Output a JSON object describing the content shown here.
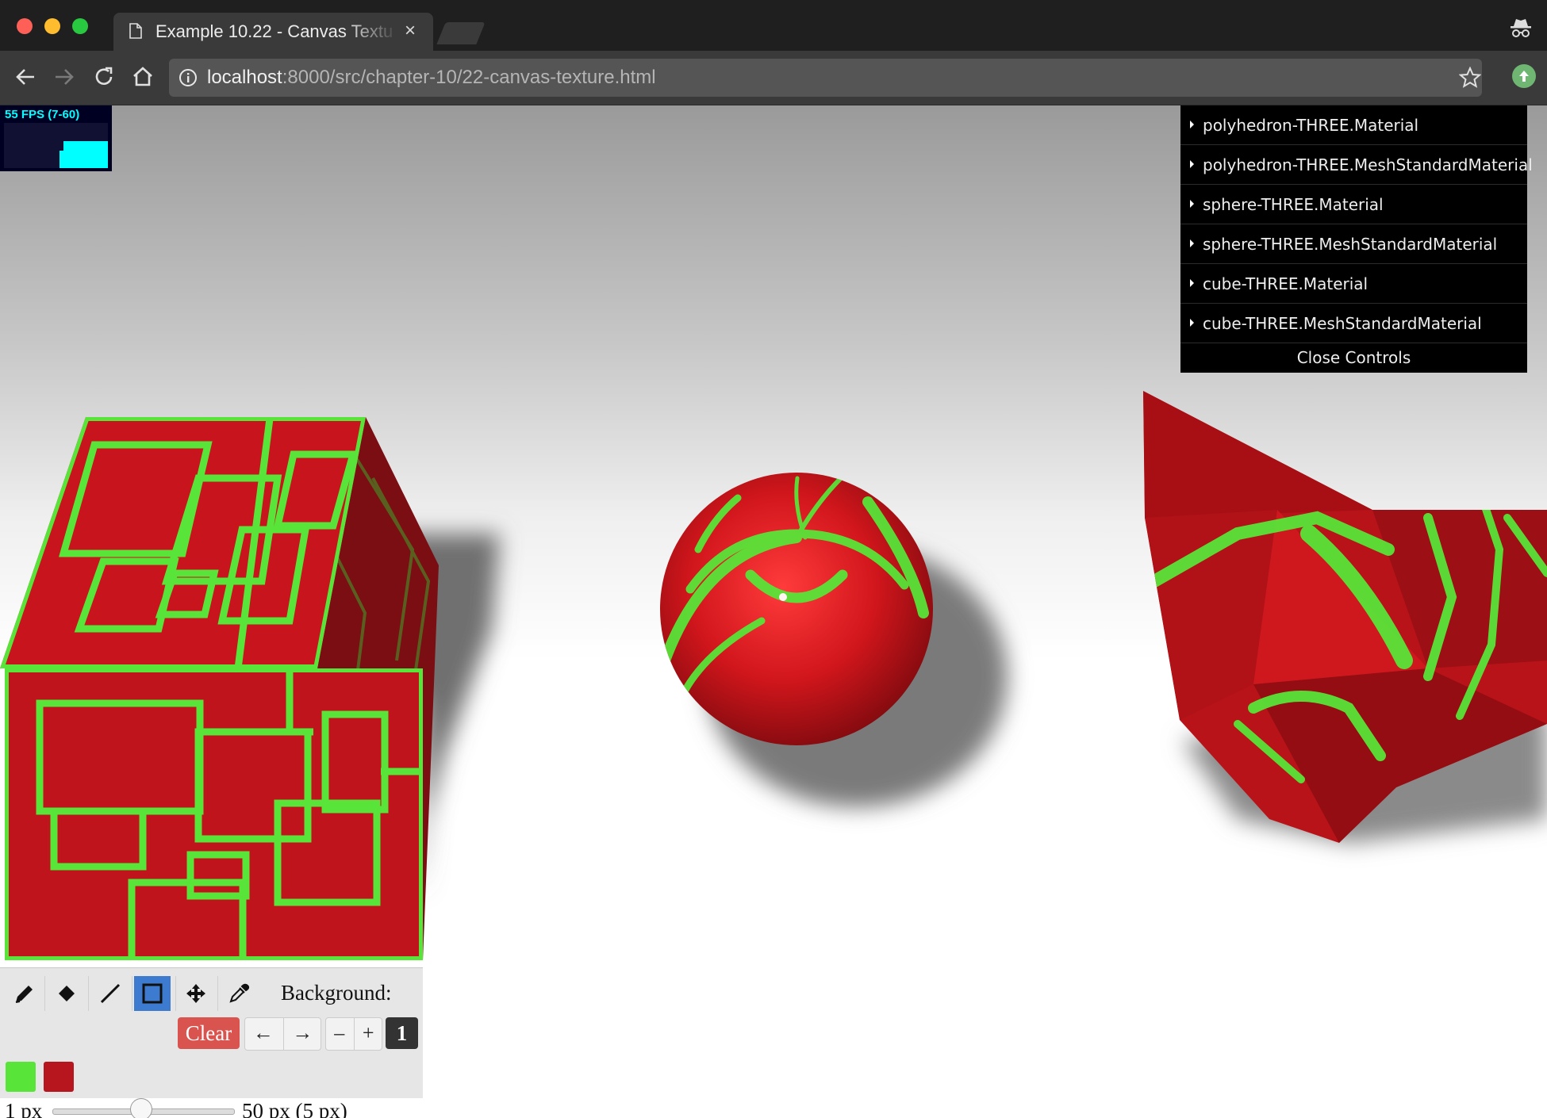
{
  "browser": {
    "tab_title": "Example 10.22 - Canvas Texture",
    "tab_close": "×",
    "url_host": "localhost",
    "url_rest": ":8000/src/chapter-10/22-canvas-texture.html"
  },
  "stats": {
    "fps_text": "55 FPS (7-60)"
  },
  "gui": {
    "folders": [
      "polyhedron-THREE.Material",
      "polyhedron-THREE.MeshStandardMaterial",
      "sphere-THREE.Material",
      "sphere-THREE.MeshStandardMaterial",
      "cube-THREE.Material",
      "cube-THREE.MeshStandardMaterial"
    ],
    "close_label": "Close Controls"
  },
  "editor": {
    "tools": [
      "pencil-icon",
      "eraser-icon",
      "line-icon",
      "rectangle-icon",
      "pan-icon",
      "eyedropper-icon"
    ],
    "active_tool": "rectangle-icon",
    "background_label": "Background:",
    "clear_label": "Clear",
    "undo_label": "←",
    "redo_label": "→",
    "zoom_out_label": "–",
    "zoom_in_label": "+",
    "zoom_value": "1",
    "primary_color": "#58e438",
    "secondary_color": "#b7161f",
    "size_min_label": "1 px",
    "size_max_label": "50 px (5 px)",
    "stroke_size_fraction": 0.09
  },
  "colors": {
    "texture_red": "#c8141c",
    "texture_green": "#58e438"
  }
}
